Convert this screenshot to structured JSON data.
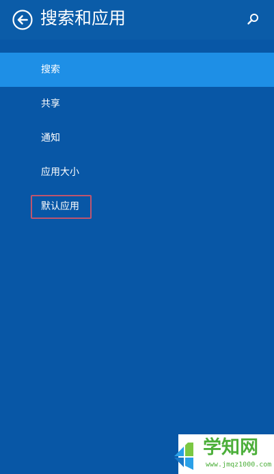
{
  "header": {
    "title": "搜索和应用"
  },
  "nav": {
    "items": [
      {
        "label": "搜索",
        "selected": true
      },
      {
        "label": "共享",
        "selected": false
      },
      {
        "label": "通知",
        "selected": false
      },
      {
        "label": "应用大小",
        "selected": false
      },
      {
        "label": "默认应用",
        "selected": false,
        "highlighted": true
      }
    ]
  },
  "icons": {
    "back": "back-arrow-circle-icon",
    "search": "search-icon"
  },
  "watermark": {
    "brand": "学知网",
    "url": "www.jmqz1000.com"
  },
  "colors": {
    "background": "#0857a6",
    "selected_item": "#1e8fe6",
    "highlight_border": "#c0556e",
    "watermark_green": "#4caf3a"
  }
}
